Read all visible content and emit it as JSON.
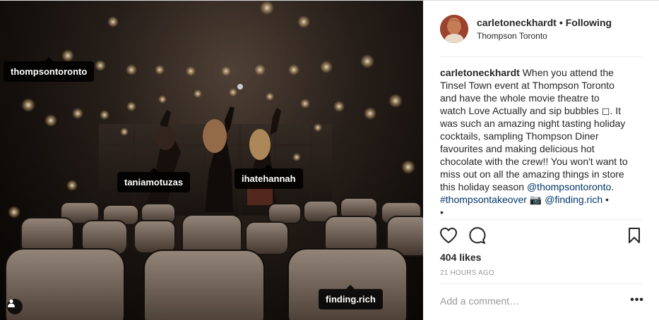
{
  "photo": {
    "tags": {
      "thompsontoronto": "thompsontoronto",
      "taniamotuzas": "taniamotuzas",
      "ihatehannah": "ihatehannah",
      "findingrich": "finding.rich"
    }
  },
  "header": {
    "username": "carletoneckhardt",
    "separator": "•",
    "follow_status": "Following",
    "location": "Thompson Toronto"
  },
  "caption": {
    "username": "carletoneckhardt",
    "text_1": " When you attend the Tinsel Town event at Thompson Toronto and have the whole movie theatre to watch Love Actually and sip bubbles ◻. It was such an amazing night tasting holiday cocktails, sampling Thompson Diner favourites and making delicious hot chocolate with the crew!! You won't want to miss out on all the amazing things in store this holiday season ",
    "mention_1": "@thompsontoronto.",
    "space_1": " ",
    "hashtag": "#thompsontakeover",
    "camera": " 📷 ",
    "mention_2": "@finding.rich",
    "tail": " •",
    "bullet_line": "•"
  },
  "likes": "404 likes",
  "timestamp": "21 HOURS AGO",
  "comment": {
    "placeholder": "Add a comment…"
  },
  "more": "•••",
  "colors": {
    "link": "#003569",
    "muted": "#999999",
    "divider": "#efefef",
    "tag_bg": "#000000"
  },
  "icons": [
    "user-tag-icon",
    "heart-icon",
    "comment-icon",
    "bookmark-icon",
    "more-options-icon"
  ]
}
